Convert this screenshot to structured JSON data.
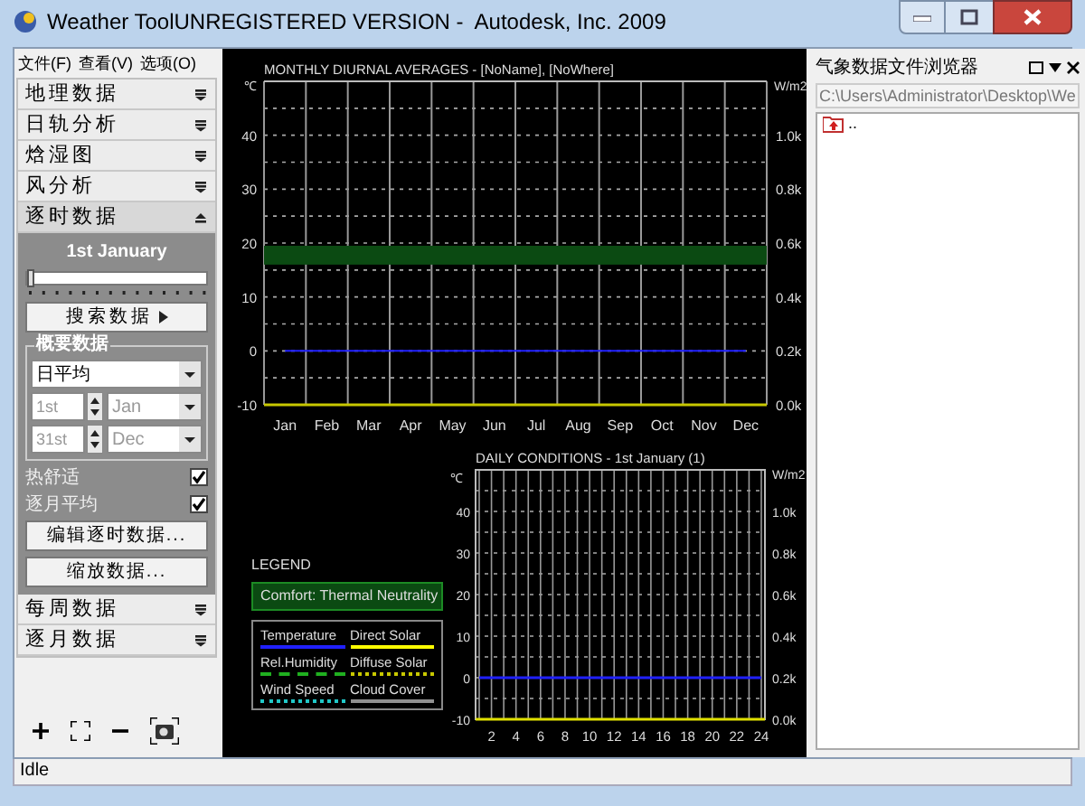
{
  "window": {
    "title": "Weather ToolUNREGISTERED VERSION -  Autodesk, Inc. 2009"
  },
  "menu": [
    {
      "label": "文件(F)"
    },
    {
      "label": "查看(V)"
    },
    {
      "label": "选项(O)"
    }
  ],
  "sections": [
    {
      "label": "地理数据",
      "expanded": false
    },
    {
      "label": "日轨分析",
      "expanded": false
    },
    {
      "label": "焓湿图",
      "expanded": false
    },
    {
      "label": "风分析",
      "expanded": false
    },
    {
      "label": "逐时数据",
      "expanded": true
    },
    {
      "label": "每周数据",
      "expanded": false
    },
    {
      "label": "逐月数据",
      "expanded": false
    }
  ],
  "hourly_panel": {
    "date": "1st January",
    "level": 0,
    "search_button": "搜索数据",
    "group_title": "概要数据",
    "mode": "日平均",
    "range": {
      "disabled": true,
      "from_day": "1st",
      "from_month": "Jan",
      "to_day": "31st",
      "to_month": "Dec"
    },
    "checks": [
      {
        "label": "热舒适",
        "checked": true
      },
      {
        "label": "逐月平均",
        "checked": true
      }
    ],
    "buttons": [
      "编辑逐时数据...",
      "缩放数据..."
    ]
  },
  "monthly_chart": {
    "chart_data": {
      "type": "line",
      "title": "MONTHLY DIURNAL AVERAGES - [NoName], [NoWhere]",
      "ylabel": "℃",
      "categories": [
        "Jan",
        "Feb",
        "Mar",
        "Apr",
        "May",
        "Jun",
        "Jul",
        "Aug",
        "Sep",
        "Oct",
        "Nov",
        "Dec"
      ],
      "ylim": [
        -10,
        50
      ],
      "yticks": [
        -10,
        0,
        10,
        20,
        30,
        40
      ],
      "grid": true,
      "series": [
        {
          "color": "#2020ff",
          "values": [
            0,
            0,
            0,
            0,
            0,
            0,
            0,
            0,
            0,
            0,
            0,
            0
          ]
        }
      ],
      "bands": [
        {
          "axis": "y",
          "from": 16,
          "to": 19.5,
          "color": "#0b4a12"
        }
      ]
    },
    "right_axis": {
      "label": "W/m2",
      "ticks": [
        "1.0k",
        "0.8k",
        "0.6k",
        "0.4k",
        "0.2k",
        "0.0k"
      ]
    }
  },
  "legend": {
    "title": "LEGEND",
    "comfort": "Comfort: Thermal Neutrality",
    "items": [
      {
        "label": "Temperature",
        "color": "#2020ff",
        "kind": "solid"
      },
      {
        "label": "Direct Solar",
        "color": "#ffff00",
        "kind": "solid"
      },
      {
        "label": "Rel.Humidity",
        "color": "#20b020",
        "kind": "dashed"
      },
      {
        "label": "Diffuse Solar",
        "color": "#c8c800",
        "kind": "dotted"
      },
      {
        "label": "Wind Speed",
        "color": "#20c8c8",
        "kind": "dotted"
      },
      {
        "label": "Cloud Cover",
        "color": "#909090",
        "kind": "solid"
      }
    ]
  },
  "daily_chart": {
    "chart_data": {
      "type": "line",
      "title": "DAILY CONDITIONS - 1st January (1)",
      "ylabel": "℃",
      "x": [
        1,
        2,
        3,
        4,
        5,
        6,
        7,
        8,
        9,
        10,
        11,
        12,
        13,
        14,
        15,
        16,
        17,
        18,
        19,
        20,
        21,
        22,
        23,
        24
      ],
      "xlim": [
        1,
        24
      ],
      "xticks": [
        2,
        4,
        6,
        8,
        10,
        12,
        14,
        16,
        18,
        20,
        22,
        24
      ],
      "ylim": [
        -10,
        50
      ],
      "yticks": [
        -10,
        0,
        10,
        20,
        30,
        40
      ],
      "grid": true,
      "series": [
        {
          "color": "#2020ff",
          "values": [
            0,
            0,
            0,
            0,
            0,
            0,
            0,
            0,
            0,
            0,
            0,
            0,
            0,
            0,
            0,
            0,
            0,
            0,
            0,
            0,
            0,
            0,
            0,
            0
          ]
        }
      ]
    },
    "right_axis": {
      "label": "W/m2",
      "ticks": [
        "1.0k",
        "0.8k",
        "0.6k",
        "0.4k",
        "0.2k",
        "0.0k"
      ]
    }
  },
  "browser": {
    "title": "气象数据文件浏览器",
    "path": "C:\\Users\\Administrator\\Desktop\\We",
    "items": [
      {
        "label": ".."
      }
    ]
  },
  "status_bar": {
    "text": "Idle"
  }
}
